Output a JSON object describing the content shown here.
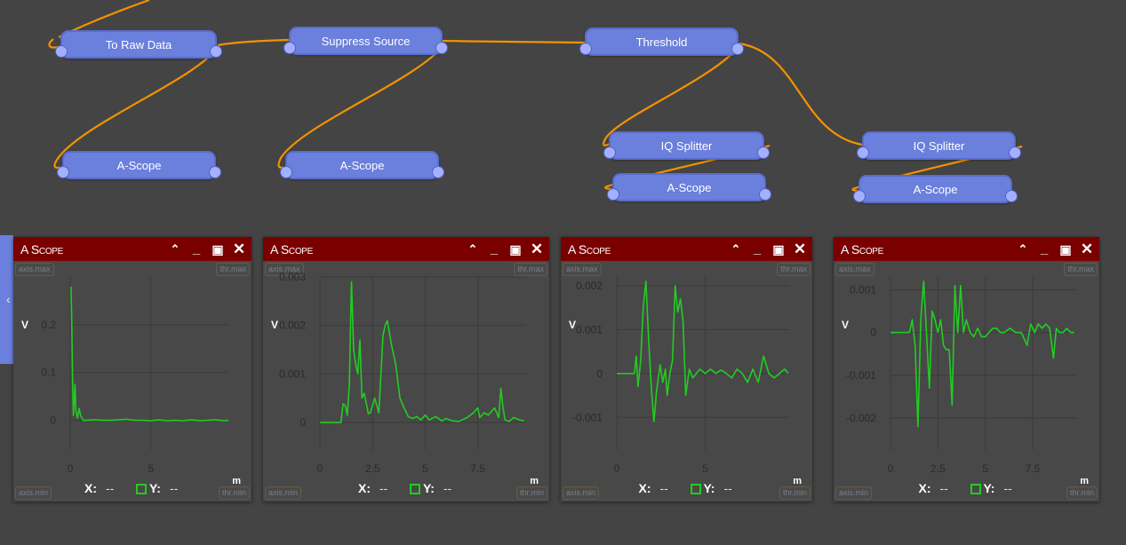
{
  "graph": {
    "nodes": [
      {
        "id": "to-raw-data",
        "label": "To Raw Data"
      },
      {
        "id": "suppress-source",
        "label": "Suppress Source"
      },
      {
        "id": "threshold",
        "label": "Threshold"
      },
      {
        "id": "a-scope-1",
        "label": "A-Scope"
      },
      {
        "id": "a-scope-2",
        "label": "A-Scope"
      },
      {
        "id": "iq-splitter-1",
        "label": "IQ Splitter"
      },
      {
        "id": "a-scope-3",
        "label": "A-Scope"
      },
      {
        "id": "iq-splitter-2",
        "label": "IQ Splitter"
      },
      {
        "id": "a-scope-4",
        "label": "A-Scope"
      }
    ],
    "wire_color": "#f39200",
    "node_color": "#6b7fdc"
  },
  "sidebar_toggle": {
    "icon": "chevron-left-icon",
    "glyph": "‹"
  },
  "scope_common": {
    "title": "A Scope",
    "tags": {
      "axis_max": "axis.max",
      "thr_max": "thr.max",
      "axis_min": "axis.min",
      "thr_min": "thr.min"
    },
    "x_readout_label": "X:",
    "y_readout_label": "Y:",
    "x_value": "--",
    "y_value": "--",
    "x_unit": "m",
    "y_unit": "V",
    "icons": {
      "collapse": "^",
      "minimize": "_",
      "maximize": "☐",
      "close": "✕"
    },
    "line_color": "#22cc22",
    "header_color": "#7a0000"
  },
  "chart_data": [
    {
      "type": "line",
      "title": "A Scope",
      "xlabel": "m",
      "ylabel": "V",
      "xlim": [
        0,
        9.8
      ],
      "ylim": [
        -0.04,
        0.3
      ],
      "xticks": [
        "0",
        "5"
      ],
      "xtick_values": [
        0,
        5
      ],
      "yticks": [
        "0",
        "0.1",
        "0.2"
      ],
      "ytick_values": [
        0,
        0.1,
        0.2
      ],
      "grid": true,
      "series": [
        {
          "name": "signal",
          "x": [
            0.05,
            0.1,
            0.15,
            0.2,
            0.3,
            0.35,
            0.45,
            0.55,
            0.65,
            0.8,
            1.0,
            1.5,
            2.0,
            2.5,
            3.0,
            3.5,
            4.0,
            4.5,
            5.0,
            5.5,
            6.0,
            6.5,
            7.0,
            7.5,
            8.0,
            8.5,
            9.0,
            9.5,
            9.8
          ],
          "y": [
            0.28,
            0.2,
            0.08,
            0.01,
            0.075,
            0.02,
            0.005,
            0.025,
            0.01,
            0.0,
            0.0,
            0.001,
            0.0,
            0.0,
            0.001,
            0.002,
            0.0,
            0.0,
            -0.001,
            0.001,
            -0.001,
            0.0,
            -0.001,
            0.001,
            -0.001,
            0.0,
            0.001,
            -0.001,
            0.0
          ]
        }
      ]
    },
    {
      "type": "line",
      "title": "A Scope",
      "xlabel": "m",
      "ylabel": "V",
      "xlim": [
        0,
        9.8
      ],
      "ylim": [
        -0.00035,
        0.003
      ],
      "xticks": [
        "0",
        "2.5",
        "5",
        "7.5"
      ],
      "xtick_values": [
        0,
        2.5,
        5,
        7.5
      ],
      "yticks": [
        "0",
        "0.001",
        "0.002",
        "0.003"
      ],
      "ytick_values": [
        0,
        0.001,
        0.002,
        0.003
      ],
      "grid": true,
      "series": [
        {
          "name": "signal",
          "x": [
            0,
            1.0,
            1.1,
            1.2,
            1.3,
            1.4,
            1.5,
            1.6,
            1.7,
            1.8,
            1.9,
            2.0,
            2.1,
            2.2,
            2.3,
            2.4,
            2.6,
            2.8,
            3.0,
            3.1,
            3.2,
            3.4,
            3.6,
            3.8,
            4.0,
            4.2,
            4.4,
            4.6,
            4.8,
            5.0,
            5.2,
            5.5,
            5.8,
            6.0,
            6.3,
            6.6,
            7.0,
            7.3,
            7.5,
            7.6,
            7.8,
            8.0,
            8.3,
            8.5,
            8.6,
            8.7,
            8.8,
            9.0,
            9.2,
            9.5,
            9.7
          ],
          "y": [
            0,
            0,
            0.00038,
            0.00035,
            0.00015,
            0.0008,
            0.0029,
            0.0015,
            0.0012,
            0.001,
            0.0017,
            0.0005,
            0.0006,
            0.0004,
            0.00018,
            0.0002,
            0.0005,
            0.0002,
            0.0018,
            0.002,
            0.0021,
            0.0016,
            0.0012,
            0.0005,
            0.0003,
            0.00012,
            8e-05,
            0.00012,
            5e-05,
            0.00015,
            5e-05,
            0.00012,
            3e-05,
            8e-05,
            3e-05,
            2e-05,
            0.0001,
            0.0002,
            0.0003,
            0.0001,
            0.0002,
            0.00015,
            0.0003,
            0.0001,
            0.0007,
            0.0003,
            5e-05,
            2e-05,
            0.0001,
            5e-05,
            3e-05
          ]
        }
      ]
    },
    {
      "type": "line",
      "title": "A Scope",
      "xlabel": "m",
      "ylabel": "V",
      "xlim": [
        0,
        9.8
      ],
      "ylim": [
        -0.0015,
        0.0022
      ],
      "xticks": [
        "0",
        "5"
      ],
      "xtick_values": [
        0,
        5
      ],
      "yticks": [
        "-0.001",
        "0",
        "0.001",
        "0.002"
      ],
      "ytick_values": [
        -0.001,
        0,
        0.001,
        0.002
      ],
      "grid": true,
      "series": [
        {
          "name": "signal",
          "x": [
            0,
            1.0,
            1.1,
            1.2,
            1.35,
            1.5,
            1.65,
            1.8,
            1.95,
            2.1,
            2.25,
            2.45,
            2.6,
            2.75,
            2.85,
            3.0,
            3.15,
            3.3,
            3.45,
            3.6,
            3.75,
            3.9,
            4.1,
            4.3,
            4.5,
            4.7,
            5.0,
            5.3,
            5.6,
            5.9,
            6.2,
            6.5,
            6.8,
            7.1,
            7.4,
            7.7,
            8.0,
            8.3,
            8.6,
            8.9,
            9.2,
            9.5,
            9.7
          ],
          "y": [
            0,
            0,
            0.0004,
            -0.0003,
            0.0003,
            0.0015,
            0.0021,
            0.0008,
            -0.0003,
            -0.0011,
            -0.0004,
            0.0002,
            -0.0002,
            0.0001,
            -0.0005,
            0.0,
            0.0003,
            0.002,
            0.0014,
            0.0017,
            0.0012,
            -0.0005,
            0.0001,
            -0.0001,
            0.0,
            0.0001,
            0.0,
            0.0001,
            0.0,
            8e-05,
            0.0,
            -0.0001,
            0.0001,
            0.0,
            -0.0002,
            0.0001,
            -0.0002,
            0.0004,
            0.0,
            -0.0001,
            0.0,
            0.0001,
            0.0
          ]
        }
      ]
    },
    {
      "type": "line",
      "title": "A Scope",
      "xlabel": "m",
      "ylabel": "V",
      "xlim": [
        0,
        9.8
      ],
      "ylim": [
        -0.0025,
        0.0013
      ],
      "xticks": [
        "0",
        "2.5",
        "5",
        "7.5"
      ],
      "xtick_values": [
        0,
        2.5,
        5,
        7.5
      ],
      "yticks": [
        "-0.002",
        "-0.001",
        "0",
        "0.001"
      ],
      "ytick_values": [
        -0.002,
        -0.001,
        0,
        0.001
      ],
      "grid": true,
      "series": [
        {
          "name": "signal",
          "x": [
            0,
            1.0,
            1.15,
            1.3,
            1.45,
            1.6,
            1.75,
            1.9,
            2.05,
            2.2,
            2.35,
            2.5,
            2.65,
            2.8,
            2.95,
            3.1,
            3.25,
            3.4,
            3.55,
            3.7,
            3.85,
            4.0,
            4.2,
            4.4,
            4.6,
            4.8,
            5.0,
            5.2,
            5.4,
            5.6,
            5.8,
            6.0,
            6.3,
            6.6,
            6.9,
            7.2,
            7.4,
            7.6,
            7.8,
            8.0,
            8.2,
            8.4,
            8.6,
            8.75,
            8.9,
            9.1,
            9.3,
            9.5,
            9.7
          ],
          "y": [
            0,
            0,
            0.0003,
            -0.0003,
            -0.0022,
            0.0003,
            0.0012,
            0.0,
            -0.0013,
            0.0005,
            0.0003,
            0.0,
            0.0003,
            -0.0003,
            -0.0004,
            -0.0004,
            -0.0017,
            0.0011,
            0.0,
            0.0011,
            0.0,
            0.0003,
            0.0,
            -0.0001,
            0.0001,
            -0.0001,
            -0.0001,
            0.0,
            0.0001,
            0.0001,
            0.0,
            0.0,
            0.0001,
            0.0,
            0.0,
            -0.0003,
            0.0002,
            0.0,
            0.0002,
            0.0001,
            0.0002,
            0.0001,
            -0.0006,
            0.0001,
            0.0,
            0.0,
            0.0001,
            0.0,
            0.0
          ]
        }
      ]
    }
  ]
}
